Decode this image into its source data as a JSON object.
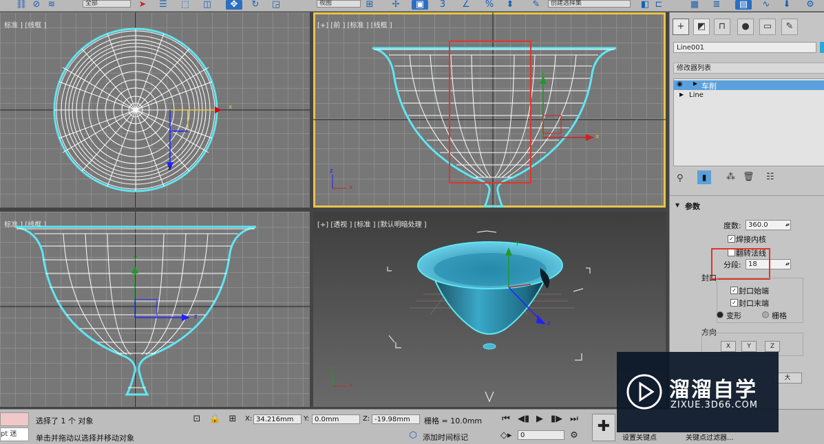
{
  "toolbar": {
    "dropdown1": "全部",
    "dropdown2": "视图",
    "dropdown3": "创建选择集",
    "icons": [
      "link-icon",
      "unlink-icon",
      "bind-icon",
      "select-icon",
      "select-by-name-icon",
      "rect-select-icon",
      "window-crossing-icon",
      "move-icon",
      "rotate-icon",
      "scale-icon",
      "snap-icon",
      "angle-snap-icon",
      "percent-snap-icon",
      "spinner-snap-icon",
      "edit-named-selection-icon",
      "mirror-icon",
      "align-icon",
      "layer-icon",
      "ribbon-icon",
      "curve-editor-icon",
      "render-setup-icon"
    ]
  },
  "viewports": {
    "top": {
      "label": "标准 ] [线框 ]"
    },
    "front": {
      "label": "[+] [前 ] [标准 ] [线框 ]"
    },
    "left": {
      "label": "标准 ] [线框 ]"
    },
    "perspective": {
      "label": "[+] [透视 ] [标准 ] [默认明暗处理 ]"
    }
  },
  "axis_labels": {
    "x": "x",
    "y": "y",
    "z": "z"
  },
  "command_panel": {
    "tabs": [
      "create-icon",
      "modify-icon",
      "hierarchy-icon",
      "motion-icon",
      "display-icon",
      "utilities-icon"
    ],
    "object_name": "Line001",
    "object_color": "#2aa8d8",
    "modifier_list_label": "修改器列表",
    "stack": [
      {
        "label": "车削",
        "selected": true
      },
      {
        "label": "Line",
        "selected": false
      }
    ],
    "rollout_title": "参数",
    "degrees_label": "度数:",
    "degrees_value": "360.0",
    "weld_core_label": "焊接内核",
    "weld_core_checked": true,
    "flip_normals_label": "翻转法线",
    "flip_normals_checked": false,
    "segments_label": "分段:",
    "segments_value": "18",
    "capping_label": "封口",
    "cap_start_label": "封口始端",
    "cap_start_checked": true,
    "cap_end_label": "封口末端",
    "cap_end_checked": true,
    "morph_label": "变形",
    "grid_label": "栅格",
    "direction_label": "方向",
    "dir_x": "X",
    "dir_y": "Y",
    "dir_z": "Z",
    "partial_button": "大"
  },
  "status": {
    "selection_text": "选择了 1 个 对象",
    "hint_text": "单击并拖动以选择并移动对象",
    "script_text": "pt 迷",
    "x_label": "X:",
    "x_value": "34.216mm",
    "y_label": "Y:",
    "y_value": "0.0mm",
    "z_label": "Z:",
    "z_value": "-19.98mm",
    "grid_text": "栅格 = 10.0mm",
    "add_time_tag": "添加时间标记",
    "frame_value": "0",
    "set_key_label": "设置关键点",
    "key_filters_label": "关键点过滤器..."
  },
  "watermark": {
    "title": "溜溜自学",
    "url": "ZIXUE.3D66.COM"
  },
  "colors": {
    "highlight_red": "#e0342c",
    "active_viewport": "#e8c547",
    "selection_cyan": "#5fe6f2"
  }
}
